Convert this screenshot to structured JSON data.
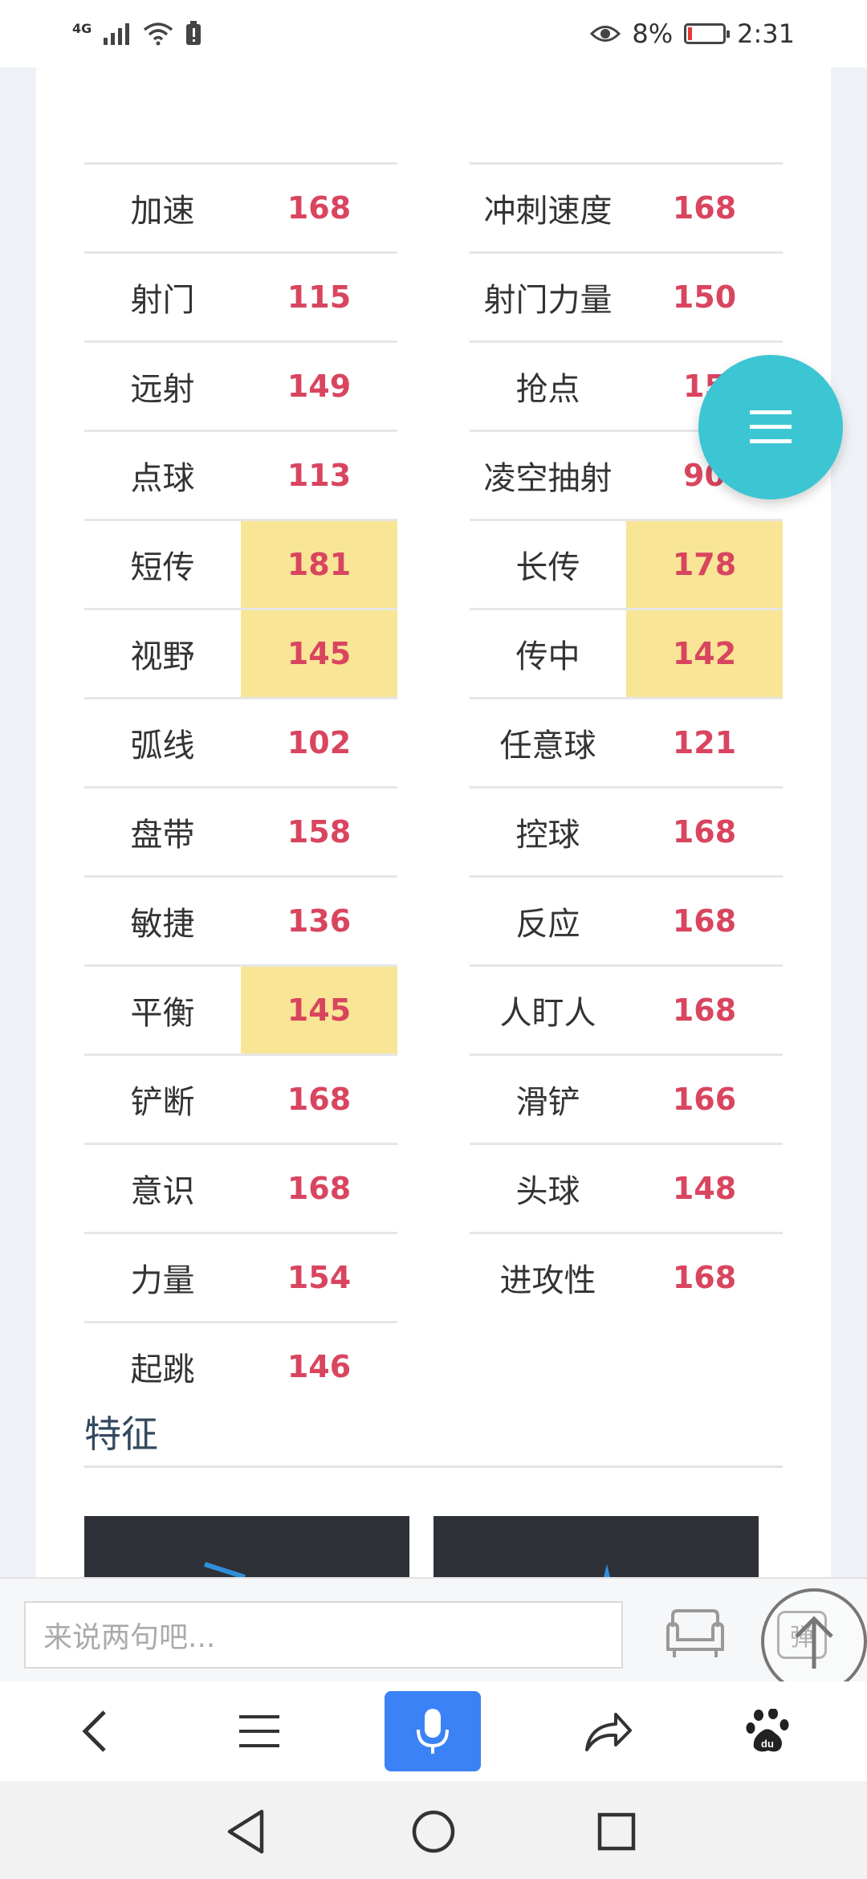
{
  "status_bar": {
    "network": "4G",
    "battery_percent": "8%",
    "time": "2:31"
  },
  "stats": {
    "left": [
      {
        "name": "加速",
        "value": "168",
        "highlight": false
      },
      {
        "name": "射门",
        "value": "115",
        "highlight": false
      },
      {
        "name": "远射",
        "value": "149",
        "highlight": false
      },
      {
        "name": "点球",
        "value": "113",
        "highlight": false
      },
      {
        "name": "短传",
        "value": "181",
        "highlight": true
      },
      {
        "name": "视野",
        "value": "145",
        "highlight": true
      },
      {
        "name": "弧线",
        "value": "102",
        "highlight": false
      },
      {
        "name": "盘带",
        "value": "158",
        "highlight": false
      },
      {
        "name": "敏捷",
        "value": "136",
        "highlight": false
      },
      {
        "name": "平衡",
        "value": "145",
        "highlight": true
      },
      {
        "name": "铲断",
        "value": "168",
        "highlight": false
      },
      {
        "name": "意识",
        "value": "168",
        "highlight": false
      },
      {
        "name": "力量",
        "value": "154",
        "highlight": false
      },
      {
        "name": "起跳",
        "value": "146",
        "highlight": false
      }
    ],
    "right": [
      {
        "name": "冲刺速度",
        "value": "168",
        "highlight": false
      },
      {
        "name": "射门力量",
        "value": "150",
        "highlight": false
      },
      {
        "name": "抢点",
        "value": "15",
        "highlight": false
      },
      {
        "name": "凌空抽射",
        "value": "90",
        "highlight": false
      },
      {
        "name": "长传",
        "value": "178",
        "highlight": true
      },
      {
        "name": "传中",
        "value": "142",
        "highlight": true
      },
      {
        "name": "任意球",
        "value": "121",
        "highlight": false
      },
      {
        "name": "控球",
        "value": "168",
        "highlight": false
      },
      {
        "name": "反应",
        "value": "168",
        "highlight": false
      },
      {
        "name": "人盯人",
        "value": "168",
        "highlight": false
      },
      {
        "name": "滑铲",
        "value": "166",
        "highlight": false
      },
      {
        "name": "头球",
        "value": "148",
        "highlight": false
      },
      {
        "name": "进攻性",
        "value": "168",
        "highlight": false
      }
    ]
  },
  "section": {
    "title": "特征"
  },
  "comment_bar": {
    "placeholder": "来说两句吧...",
    "danmu_label": "弹"
  },
  "toolbar": {
    "icons": [
      "back-icon",
      "menu-icon",
      "microphone-icon",
      "share-icon",
      "baidu-paw-icon"
    ]
  },
  "nav": {
    "icons": [
      "nav-back-icon",
      "nav-home-icon",
      "nav-recents-icon"
    ]
  },
  "colors": {
    "value_red": "#d9455f",
    "highlight_yellow": "#f9e596",
    "fab_teal": "#3cc5d3",
    "mic_blue": "#3b82f6"
  }
}
